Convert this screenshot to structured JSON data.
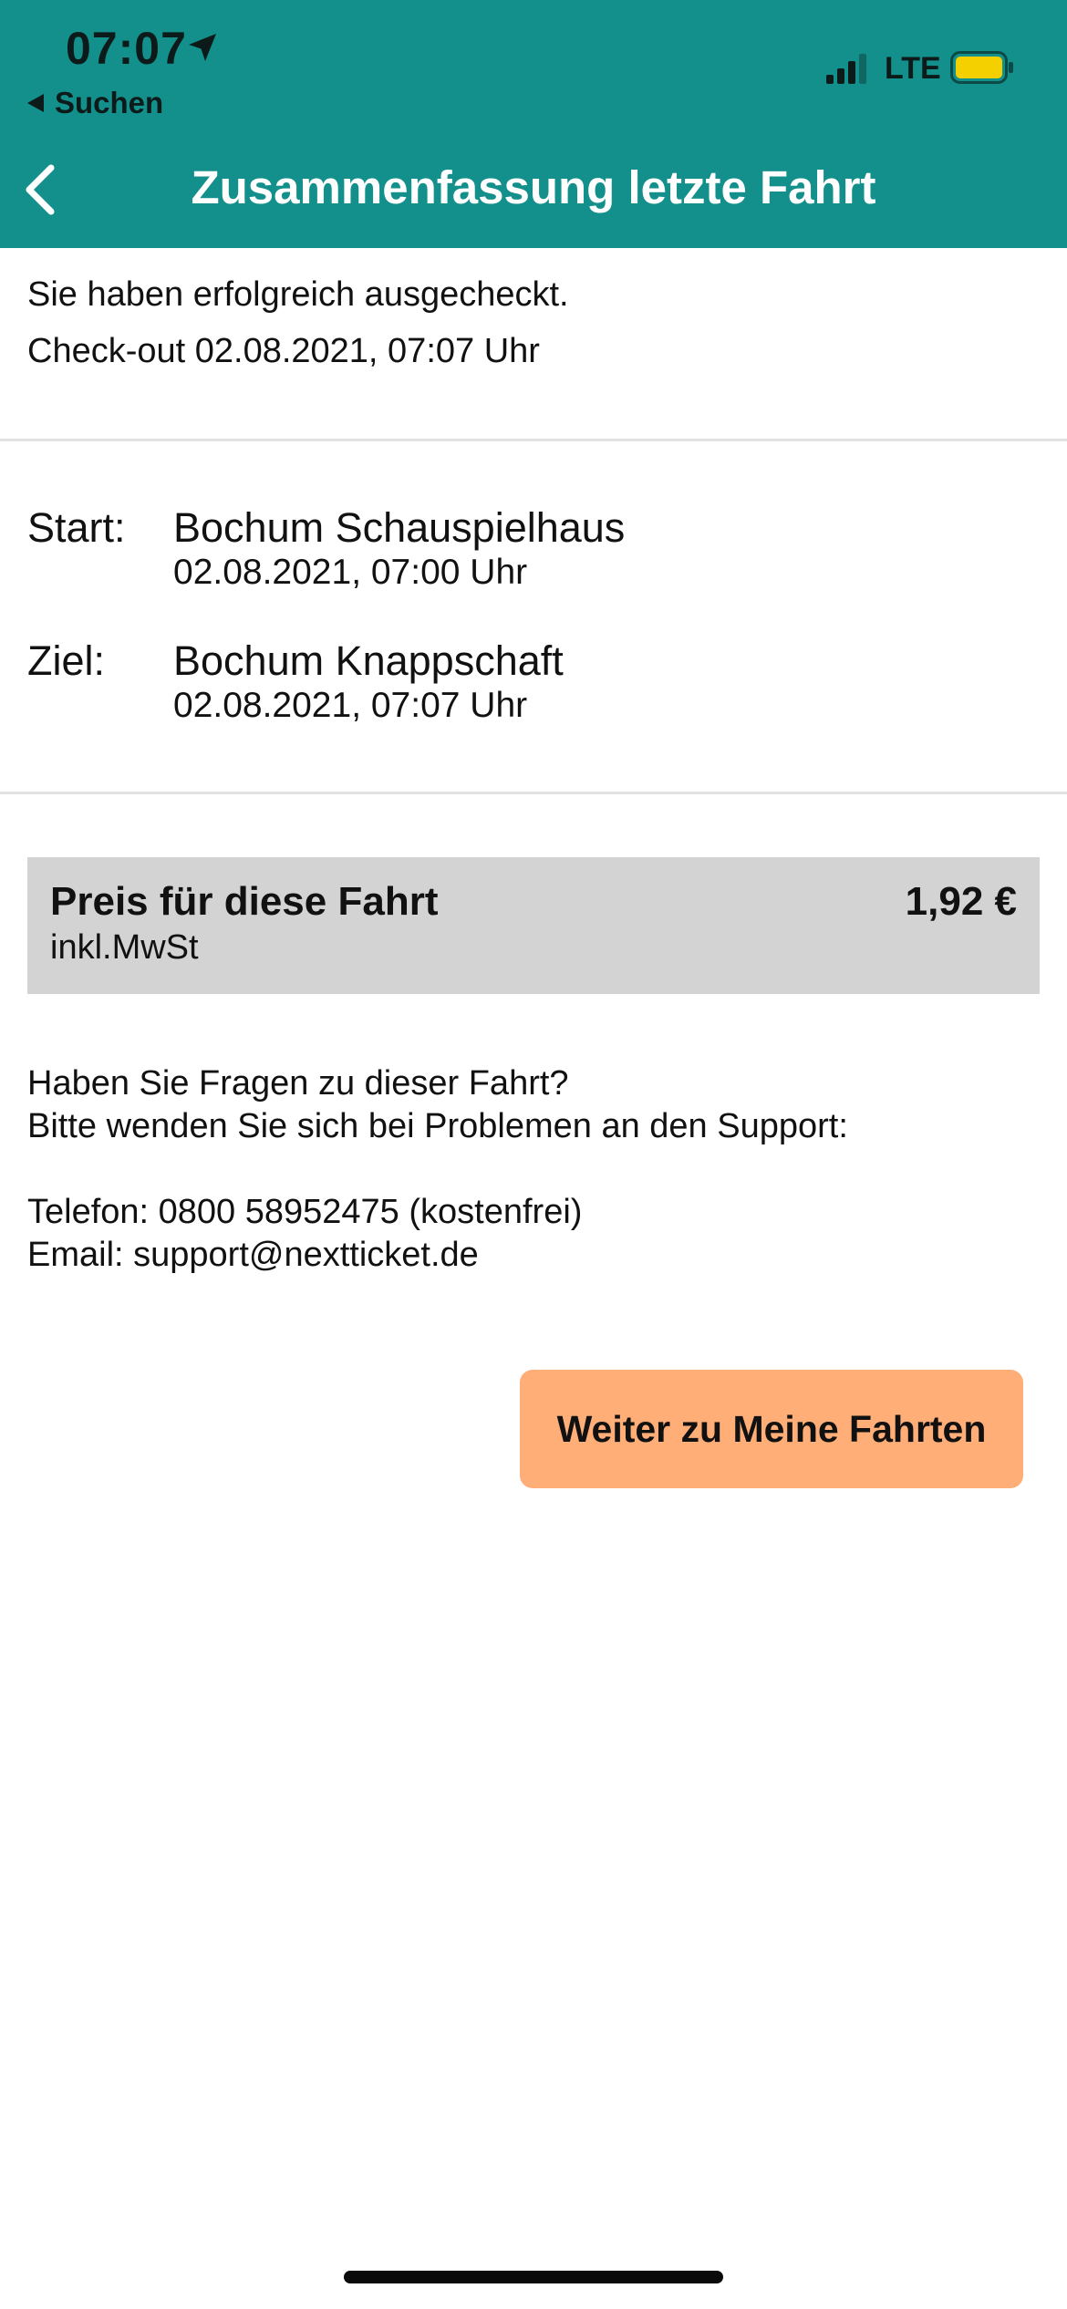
{
  "status_bar": {
    "time": "07:07",
    "back_app_label": "Suchen",
    "network": "LTE"
  },
  "nav": {
    "title": "Zusammenfassung letzte Fahrt"
  },
  "checkout": {
    "message": "Sie haben erfolgreich ausgecheckt.",
    "datetime": "Check-out 02.08.2021, 07:07 Uhr"
  },
  "trip": {
    "start_label": "Start:",
    "start_station": "Bochum Schauspielhaus",
    "start_time": "02.08.2021, 07:00 Uhr",
    "destination_label": "Ziel:",
    "destination_station": "Bochum Knappschaft",
    "destination_time": "02.08.2021, 07:07 Uhr"
  },
  "price": {
    "title": "Preis für diese Fahrt",
    "tax_note": "inkl.MwSt",
    "value": "1,92 €"
  },
  "support": {
    "question": "Haben Sie Fragen zu dieser Fahrt?",
    "instruction": "Bitte wenden Sie sich bei Problemen an den Support:",
    "phone": "Telefon: 0800 58952475 (kostenfrei)",
    "email": "Email: support@nextticket.de"
  },
  "actions": {
    "continue_label": "Weiter zu Meine Fahrten"
  },
  "colors": {
    "header": "#13908b",
    "price_box": "#d3d3d3",
    "button": "#ffae78",
    "battery": "#f5d000"
  },
  "icons": {
    "location": "location-arrow-icon",
    "signal": "cellular-signal-icon",
    "battery": "battery-icon",
    "back_app": "back-triangle-icon",
    "nav_back": "chevron-left-icon"
  }
}
